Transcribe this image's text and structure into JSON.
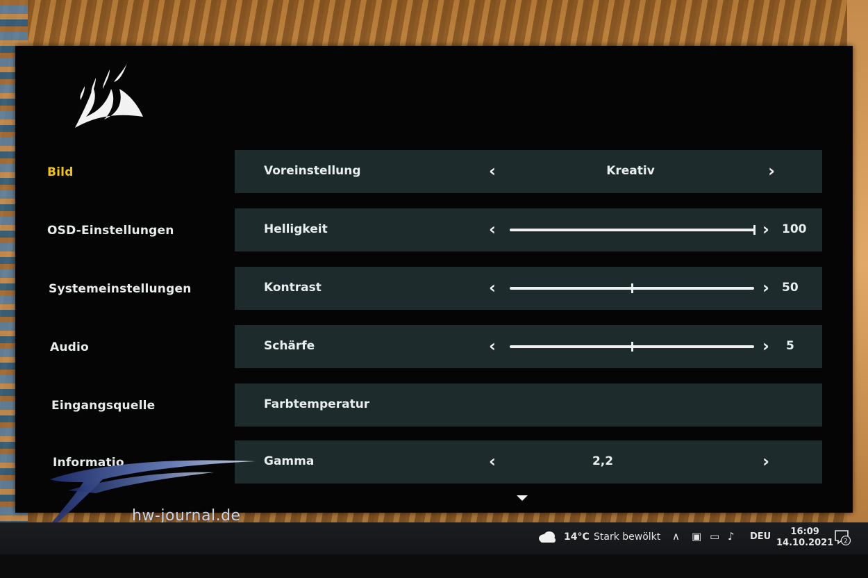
{
  "menu": {
    "items": [
      {
        "label": "Bild",
        "active": true
      },
      {
        "label": "OSD-Einstellungen",
        "active": false
      },
      {
        "label": "Systemeinstellungen",
        "active": false
      },
      {
        "label": "Audio",
        "active": false
      },
      {
        "label": "Eingangsquelle",
        "active": false
      },
      {
        "label": "Informatio",
        "active": false
      }
    ]
  },
  "settings": {
    "preset": {
      "label": "Voreinstellung",
      "value": "Kreativ"
    },
    "brightness": {
      "label": "Helligkeit",
      "value": 100,
      "min": 0,
      "max": 100,
      "display": "100"
    },
    "contrast": {
      "label": "Kontrast",
      "value": 50,
      "min": 0,
      "max": 100,
      "display": "50"
    },
    "sharpness": {
      "label": "Schärfe",
      "value": 5,
      "min": 0,
      "max": 10,
      "display": "5"
    },
    "color_temp": {
      "label": "Farbtemperatur"
    },
    "gamma": {
      "label": "Gamma",
      "value": "2,2"
    }
  },
  "watermark": {
    "text": "hw-journal.de"
  },
  "taskbar": {
    "weather_temp": "14°C",
    "weather_desc": "Stark bewölkt",
    "language": "DEU",
    "time": "16:09",
    "date": "14.10.2021",
    "notification_count": "2"
  },
  "colors": {
    "active_menu": "#f1c40f",
    "row_bg": "#1e2b2d",
    "osd_bg": "#050505"
  }
}
